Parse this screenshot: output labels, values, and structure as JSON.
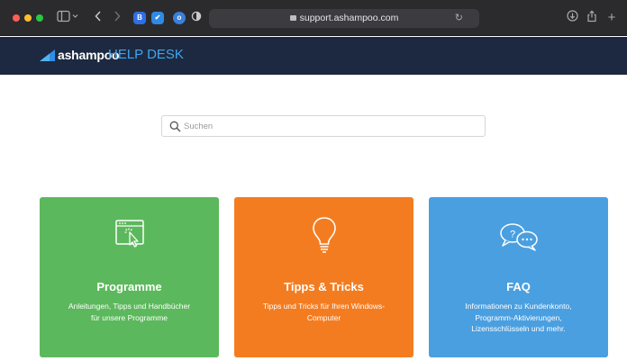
{
  "browser": {
    "url": "support.ashampoo.com",
    "icons": [
      "sidebar-icon",
      "back-icon",
      "forward-icon",
      "reload-icon",
      "download-icon",
      "share-icon",
      "new-tab-icon"
    ],
    "extensions": [
      {
        "name": "extension-b-icon",
        "label": "B",
        "color": "#2f6fe4"
      },
      {
        "name": "extension-shield-icon",
        "label": "✔",
        "color": "#2f8ae4"
      },
      {
        "name": "extension-o-icon",
        "label": "o",
        "color": "#3b7fd9"
      }
    ]
  },
  "header": {
    "logo": "ashampoo",
    "title": "HELP DESK",
    "logo_color": "#2f8ee6",
    "title_color": "#3ea6ef",
    "background": "#1d2940"
  },
  "search": {
    "placeholder": "Suchen",
    "value": ""
  },
  "cards": [
    {
      "title": "Programme",
      "desc_lines": [
        "Anleitungen, Tipps und Handbücher",
        "für unsere Programme"
      ],
      "color": "#5cb85c",
      "icon": "window-pointer-icon"
    },
    {
      "title": "Tipps & Tricks",
      "desc_lines": [
        "Tipps und Tricks für Ihren Windows-",
        "Computer"
      ],
      "color": "#f47c20",
      "icon": "lightbulb-icon"
    },
    {
      "title": "FAQ",
      "desc_lines": [
        "Informationen zu Kundenkonto,",
        "Programm-Aktivierungen,",
        "Lizensschlüsseln und mehr."
      ],
      "color": "#4a9fe0",
      "icon": "chat-bubbles-icon"
    }
  ]
}
